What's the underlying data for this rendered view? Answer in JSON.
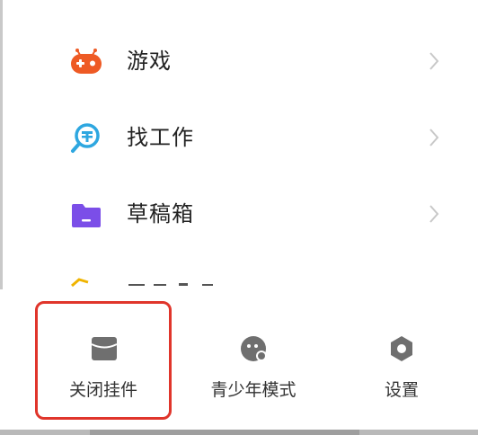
{
  "menu": {
    "items": [
      {
        "label": "游戏",
        "icon": "game-controller-icon",
        "color": "#ee5a24"
      },
      {
        "label": "找工作",
        "icon": "job-search-icon",
        "color": "#2ea7e0"
      },
      {
        "label": "草稿箱",
        "icon": "folder-icon",
        "color": "#7b4ee8"
      }
    ]
  },
  "bottom_bar": {
    "tabs": [
      {
        "label": "关闭挂件",
        "icon": "widget-box-icon",
        "highlighted": true
      },
      {
        "label": "青少年模式",
        "icon": "teen-mode-icon",
        "highlighted": false
      },
      {
        "label": "设置",
        "icon": "settings-gear-icon",
        "highlighted": false
      }
    ]
  },
  "colors": {
    "highlight_border": "#e0352b",
    "icon_gray": "#6f6f6f",
    "chevron": "#c8c8c8"
  }
}
